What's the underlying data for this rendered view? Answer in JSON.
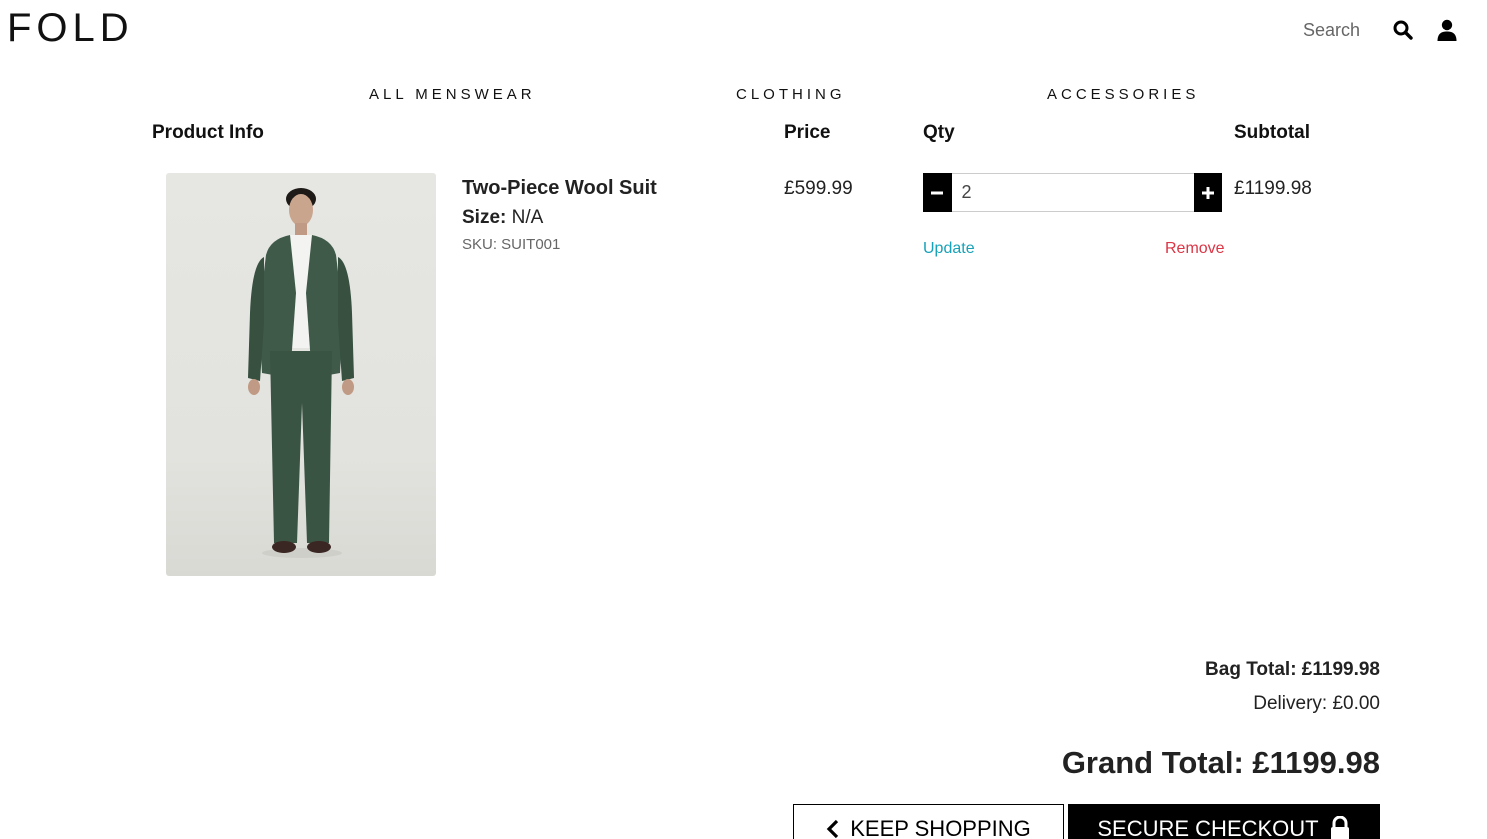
{
  "header": {
    "logo": "FOLD",
    "search_placeholder": "Search",
    "search_icon": "search-icon",
    "account_icon": "user-icon"
  },
  "nav": {
    "items": [
      {
        "label": "ALL MENSWEAR"
      },
      {
        "label": "CLOTHING"
      },
      {
        "label": "ACCESSORIES"
      }
    ]
  },
  "table": {
    "headers": {
      "product_info": "Product Info",
      "price": "Price",
      "qty": "Qty",
      "subtotal": "Subtotal"
    }
  },
  "items": [
    {
      "name": "Two-Piece Wool Suit",
      "size_label": "Size:",
      "size_value": "N/A",
      "sku": "SKU: SUIT001",
      "price": "£599.99",
      "quantity": "2",
      "subtotal": "£1199.98",
      "update_label": "Update",
      "remove_label": "Remove",
      "image_icon": "product-photo"
    }
  ],
  "totals": {
    "bag_total": "Bag Total: £1199.98",
    "delivery": "Delivery: £0.00",
    "grand_total": "Grand Total: £1199.98"
  },
  "actions": {
    "keep_shopping": "KEEP SHOPPING",
    "secure_checkout": "SECURE CHECKOUT"
  },
  "colors": {
    "update_link": "#17a2b8",
    "remove_link": "#dc3545",
    "button_dark": "#000000"
  }
}
